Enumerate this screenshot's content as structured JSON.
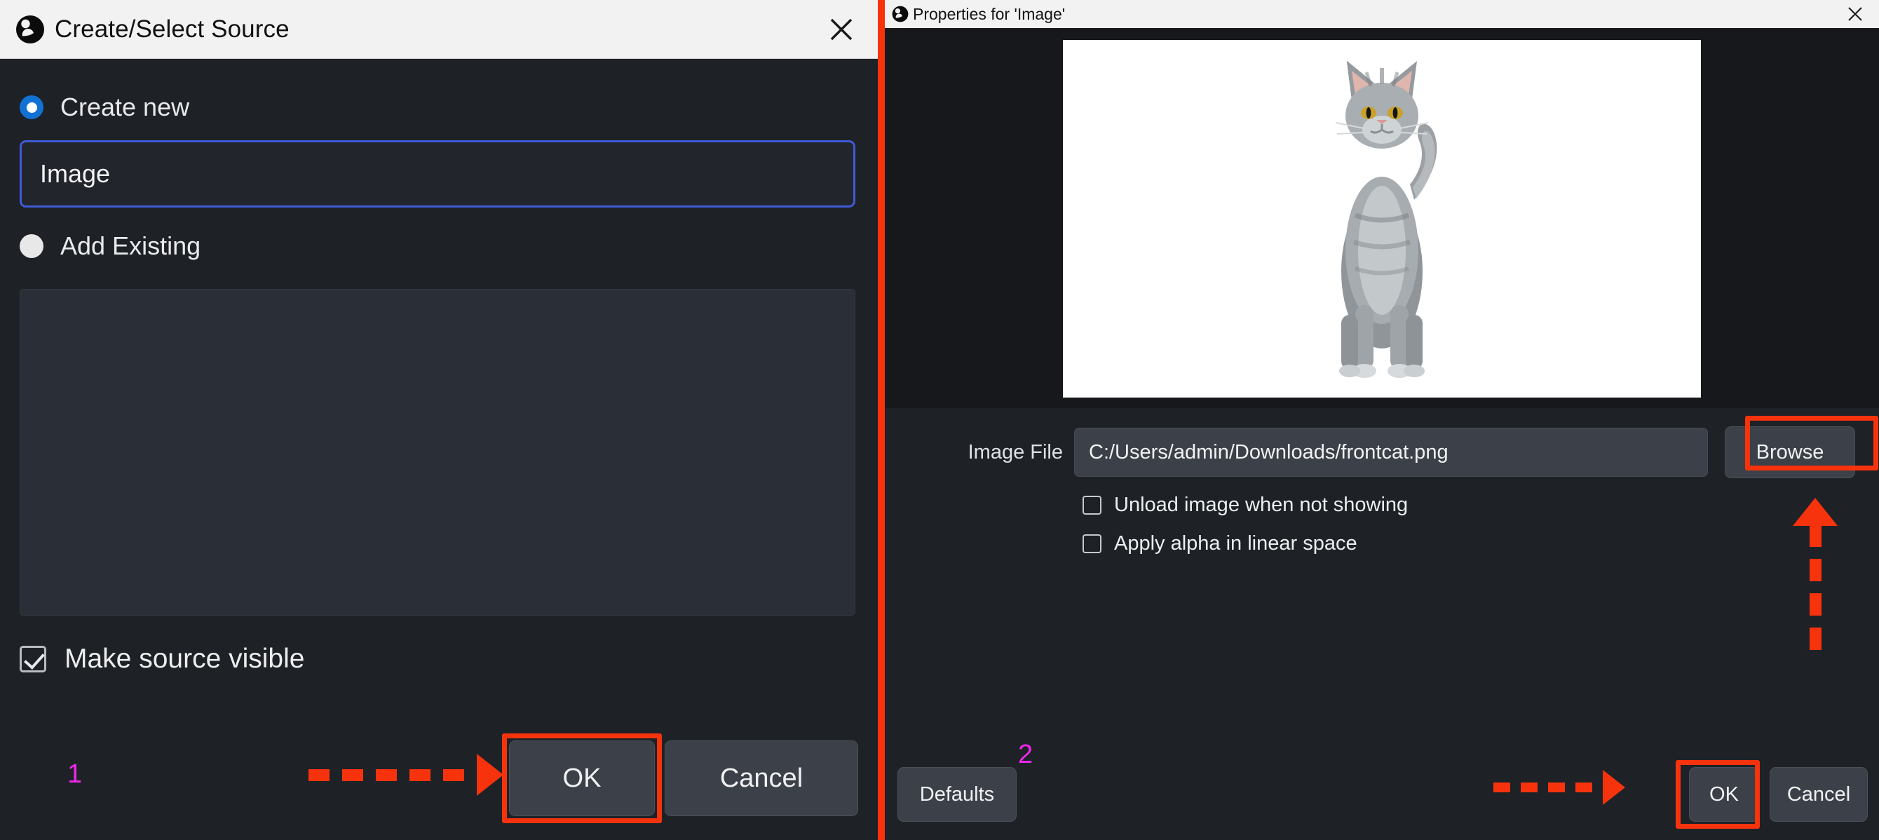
{
  "create_source_dialog": {
    "title": "Create/Select Source",
    "logo_icon": "obs-logo-icon",
    "close_icon": "close-icon",
    "create_new": {
      "label": "Create new",
      "selected": true,
      "radio_icon": "radio-selected-icon"
    },
    "source_name_input": {
      "value": "Image",
      "placeholder": ""
    },
    "add_existing": {
      "label": "Add Existing",
      "selected": false,
      "radio_icon": "radio-unselected-icon"
    },
    "existing_sources_list": {
      "items": []
    },
    "make_source_visible": {
      "label": "Make source visible",
      "checked": true,
      "check_icon": "checkmark-icon"
    },
    "ok_label": "OK",
    "cancel_label": "Cancel"
  },
  "properties_dialog": {
    "title": "Properties for 'Image'",
    "logo_icon": "obs-logo-icon",
    "close_icon": "close-icon",
    "preview": {
      "alt": "grey tabby cat walking toward camera on white background"
    },
    "image_file": {
      "label": "Image File",
      "value": "C:/Users/admin/Downloads/frontcat.png",
      "browse_label": "Browse"
    },
    "unload_image": {
      "label": "Unload image when not showing",
      "checked": false
    },
    "apply_alpha": {
      "label": "Apply alpha in linear space",
      "checked": false
    },
    "defaults_label": "Defaults",
    "ok_label": "OK",
    "cancel_label": "Cancel"
  },
  "annotations": {
    "step_one": "1",
    "step_two": "2",
    "arrow_to_left_ok": "arrow-right-icon",
    "arrow_to_right_ok": "arrow-right-icon",
    "arrow_to_browse": "arrow-up-icon",
    "highlight_color": "#f6330d",
    "step_color": "#ef27ef"
  }
}
